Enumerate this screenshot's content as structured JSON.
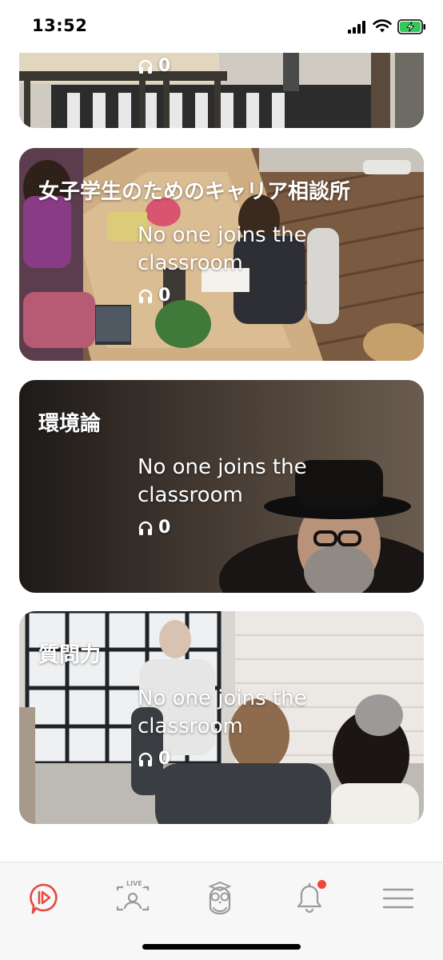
{
  "status_bar": {
    "time": "13:52"
  },
  "classrooms": [
    {
      "title": "",
      "status": "",
      "listeners": "0"
    },
    {
      "title": "女子学生のためのキャリア相談所",
      "status": "No one joins the classroom",
      "listeners": "0"
    },
    {
      "title": "環境論",
      "status": "No one joins the classroom",
      "listeners": "0"
    },
    {
      "title": "質問力",
      "status": "No one joins the classroom",
      "listeners": "0"
    }
  ],
  "tab_bar": {
    "live_badge": "LIVE",
    "active_color": "#e8483d",
    "inactive_color": "#9a9a9a",
    "icons": [
      "play-bubble-icon",
      "live-camera-icon",
      "owl-icon",
      "bell-icon",
      "menu-icon"
    ],
    "notification_dot": true
  }
}
